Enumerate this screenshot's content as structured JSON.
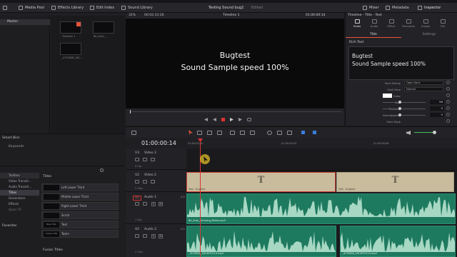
{
  "toolbar": {
    "media_pool": "Media Pool",
    "effects_library": "Effects Library",
    "edit_index": "Edit Index",
    "sound_library": "Sound Library",
    "project_title": "Testing Sound bug2",
    "edited": "Edited",
    "mixer": "Mixer",
    "metadata": "Metadata",
    "inspector": "Inspector"
  },
  "viewer": {
    "zoom": "32%",
    "source_timecode": "00:02:33:28",
    "timeline_name": "Timeline 1",
    "timecode": "01:00:00:14",
    "title_line1": "Bugtest",
    "title_line2": "Sound Sample speed 100%"
  },
  "media_pool": {
    "master": "Master",
    "clips": [
      {
        "label": "Timeline 1"
      },
      {
        "label": "Bit_Ants_..."
      },
      {
        "label": "_4170828_161..."
      }
    ]
  },
  "smart_bins": {
    "title": "Smart Bins",
    "keywords": "Keywords"
  },
  "effects": {
    "tree": [
      "Toolbox",
      "Video Transiti...",
      "Audio Transiti...",
      "Titles",
      "Generators",
      "Effects",
      "Open FX"
    ],
    "favorites": "Favorites",
    "section_titles": "Titles",
    "section_fusion": "Fusion Titles",
    "items": [
      {
        "thumb": "",
        "label": "Left Lower Third"
      },
      {
        "thumb": "",
        "label": "Middle Lower Third"
      },
      {
        "thumb": "",
        "label": "Right Lower Third"
      },
      {
        "thumb": "",
        "label": "Scroll"
      },
      {
        "thumb": "Basic Title",
        "label": "Text"
      },
      {
        "thumb": "Custom Title",
        "label": "Text+"
      }
    ]
  },
  "inspector": {
    "header": "Timeline - Title - Text",
    "tabs": [
      "Video",
      "Audio",
      "Effect",
      "Transition",
      "Image",
      "File"
    ],
    "subtabs": [
      "Title",
      "Settings"
    ],
    "rich_text_label": "Rich Text",
    "rich_text_line1": "Bugtest",
    "rich_text_line2": "Sound Sample speed 100%",
    "props": [
      {
        "label": "Font Family",
        "value": "Open Sans"
      },
      {
        "label": "Font Face",
        "value": "Normal"
      },
      {
        "label": "Color",
        "value": ""
      },
      {
        "label": "Size",
        "value": "96"
      },
      {
        "label": "Tracking",
        "value": "0"
      },
      {
        "label": "Line Spacing",
        "value": "0"
      },
      {
        "label": "Font Style",
        "value": ""
      }
    ]
  },
  "timeline": {
    "timecode": "01:00:00:14",
    "ruler": [
      "01:00:00:00",
      "01:00:04:03",
      "01:00:08:06"
    ],
    "tracks": [
      {
        "id": "V3",
        "name": "Video 3",
        "count": "0 Clip"
      },
      {
        "id": "V2",
        "name": "Video 2",
        "count": "2 Clips"
      },
      {
        "id": "A1",
        "name": "Audio 1",
        "level": "2.0",
        "count": "1 Clip"
      },
      {
        "id": "A2",
        "name": "Audio 2",
        "level": "2.0",
        "count": "2 Clips"
      }
    ],
    "clips": {
      "v2a": "Text - Bugtest",
      "v2b": "Text - Bugtest",
      "a1": "Bit_Ants__Echoing_Remix.mp3",
      "a2a": "_4170828_1613070113.mp3",
      "a2b": "_4170828_1613070113.mp3"
    }
  },
  "colors": {
    "accent": "#e3533a",
    "title_clip": "#c8bc9d",
    "audio_clip": "#1e7a5f",
    "waveform": "#bfe9d6"
  }
}
